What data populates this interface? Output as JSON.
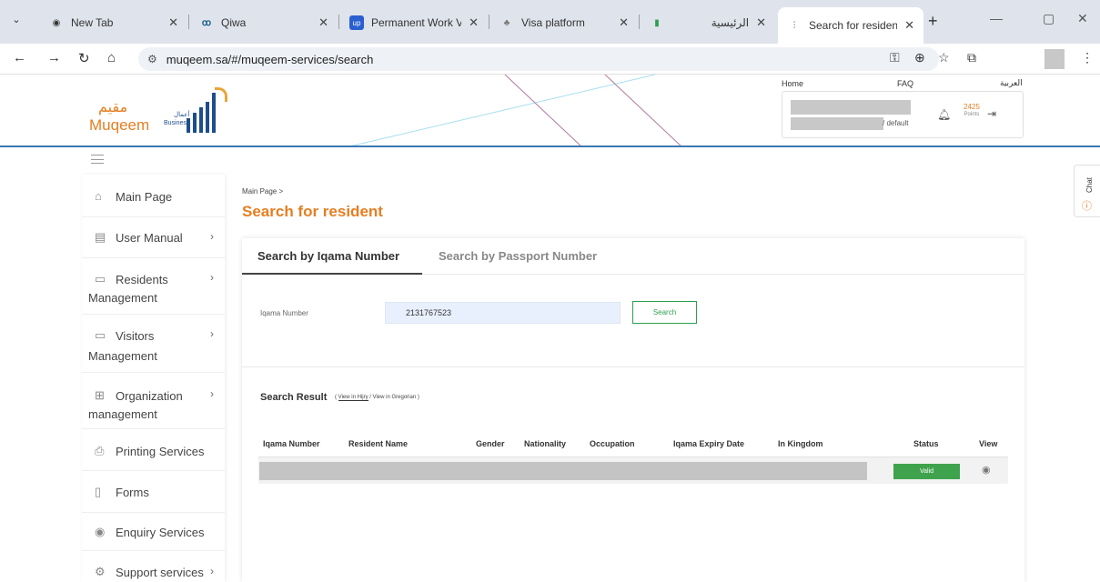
{
  "browser": {
    "tabs": [
      {
        "title": "New Tab",
        "icon": "chrome-icon"
      },
      {
        "title": "Qiwa",
        "icon": "qiwa-icon"
      },
      {
        "title": "Permanent Work Visa",
        "icon": "upwork-icon"
      },
      {
        "title": "Visa platform",
        "icon": "visa-platform-icon"
      },
      {
        "title": "الرئيسية",
        "icon": "green-flag-icon"
      },
      {
        "title": "Search for resident",
        "icon": "muqeem-icon",
        "active": true
      }
    ],
    "new_tab": "+",
    "url": "muqeem.sa/#/muqeem-services/search"
  },
  "header": {
    "logo_ar": "مقيم",
    "logo_en": "Muqeem",
    "logo_tag_ar": "أعمال",
    "logo_tag_en": "Business",
    "links": {
      "home": "Home",
      "faq": "FAQ",
      "arabic": "العربية"
    },
    "user_role": "/ default",
    "points_value": "2425",
    "points_label": "Points"
  },
  "sidebar": {
    "items": [
      {
        "label": "Main Page",
        "icon": "home-icon"
      },
      {
        "label": "User Manual",
        "icon": "manual-icon",
        "arrow": true
      },
      {
        "label": "Residents",
        "cont": "Management",
        "icon": "residents-icon",
        "arrow": true
      },
      {
        "label": "Visitors",
        "cont": "Management",
        "icon": "visitors-icon",
        "arrow": true
      },
      {
        "label": "Organization",
        "cont": "management",
        "icon": "organization-icon",
        "arrow": true
      },
      {
        "label": "Printing Services",
        "icon": "printer-icon"
      },
      {
        "label": "Forms",
        "icon": "forms-icon"
      },
      {
        "label": "Enquiry Services",
        "icon": "eye-icon"
      },
      {
        "label": "Support services",
        "icon": "support-icon",
        "arrow": true
      }
    ]
  },
  "main": {
    "breadcrumb": "Main Page >",
    "title": "Search for resident",
    "tabs": [
      {
        "label": "Search by Iqama Number",
        "active": true
      },
      {
        "label": "Search by Passport Number",
        "active": false
      }
    ],
    "field_label": "Iqama Number",
    "iqama_value": "2131767523",
    "search_button": "Search",
    "result_title": "Search Result",
    "result_opt_open": "( ",
    "result_opt_hijri": "View in Hijry",
    "result_opt_greg": " / View in Gregorian )",
    "columns": [
      "Iqama Number",
      "Resident Name",
      "Gender",
      "Nationality",
      "Occupation",
      "Iqama Expiry Date",
      "In Kingdom",
      "Status",
      "View"
    ],
    "row": {
      "status": "Valid"
    }
  },
  "chat": {
    "label": "Chat"
  },
  "colors": {
    "accent": "#e67e22",
    "brand_blue": "#1e4d8c",
    "valid_green": "#3fa34d",
    "header_border": "#3a78b5"
  }
}
